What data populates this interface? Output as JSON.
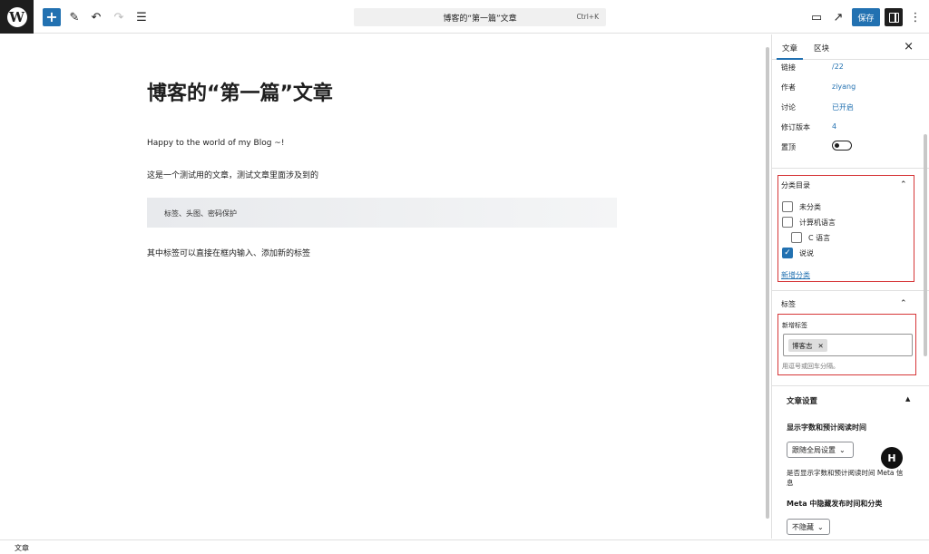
{
  "toolbar": {
    "logo_glyph": "W",
    "add_glyph": "+",
    "pen_glyph": "✎",
    "undo_glyph": "↶",
    "redo_glyph": "↷",
    "list_glyph": "☰",
    "command_title": "博客的“第一篇”文章",
    "command_shortcut": "Ctrl+K",
    "view_glyph": "▭",
    "external_glyph": "↗",
    "save_label": "保存",
    "more_glyph": "⋮"
  },
  "editor": {
    "title": "博客的“第一篇”文章",
    "paragraph_1": "Happy to the world of my Blog ~!",
    "paragraph_2": "这是一个测试用的文章，测试文章里面涉及到的",
    "quote_text": "标签、头图、密码保护",
    "paragraph_3": "其中标签可以直接在框内输入、添加新的标签"
  },
  "sidebar": {
    "tab_post": "文章",
    "tab_block": "区块",
    "close_glyph": "×",
    "meta": [
      {
        "label": "链接",
        "value": "/22"
      },
      {
        "label": "作者",
        "value": "ziyang"
      },
      {
        "label": "讨论",
        "value": "已开启"
      },
      {
        "label": "修订版本",
        "value": "4"
      }
    ],
    "sticky_label": "置顶",
    "categories": {
      "title": "分类目录",
      "chevron": "⌃",
      "items": [
        {
          "label": "未分类",
          "checked": false
        },
        {
          "label": "计算机语言",
          "checked": false
        },
        {
          "label": "C 语言",
          "checked": false
        },
        {
          "label": "说说",
          "checked": true
        }
      ],
      "add_link": "新增分类"
    },
    "tags": {
      "title": "标签",
      "chevron": "⌃",
      "field_label": "新增标签",
      "chip": "博客志",
      "chip_remove": "✕",
      "help": "用逗号或回车分隔。"
    },
    "post_settings": {
      "title": "文章设置",
      "triangle": "▲",
      "word_count_heading": "显示字数和预计阅读时间",
      "word_count_select": "跟随全局设置",
      "word_count_help": "是否显示字数和预计阅读时间 Meta 信息",
      "hide_meta_heading": "Meta 中隐藏发布时间和分类",
      "hide_meta_select": "不隐藏",
      "select_chevron": "⌄"
    },
    "floating_badge": "H"
  },
  "footer": {
    "breadcrumb": "文章"
  }
}
